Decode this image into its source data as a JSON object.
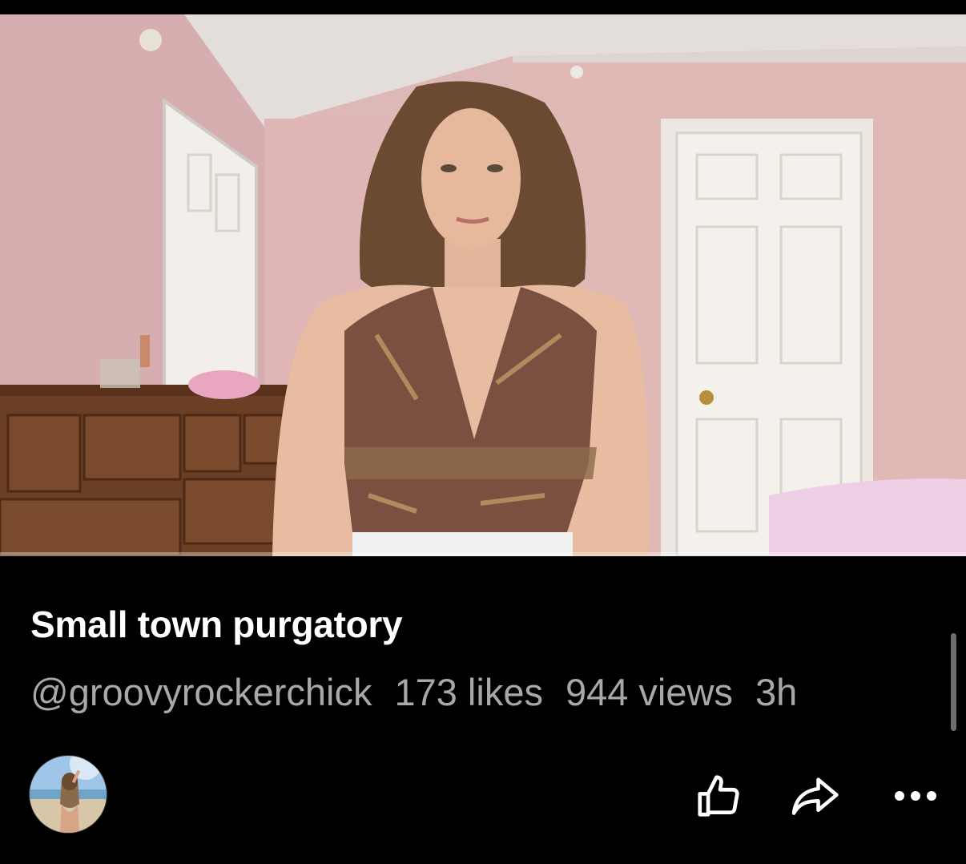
{
  "video": {
    "thumbnail_icon": "video-frame",
    "progress": 0
  },
  "post": {
    "title": "Small town purgatory",
    "handle": "@groovyrockerchick",
    "likes": "173 likes",
    "views": "944 views",
    "age": "3h"
  },
  "actions": {
    "like_icon": "thumbs-up-icon",
    "share_icon": "share-arrow-icon",
    "more_icon": "more-dots-icon"
  },
  "colors": {
    "background": "#000000",
    "title": "#ffffff",
    "meta": "#a8a8a8"
  }
}
